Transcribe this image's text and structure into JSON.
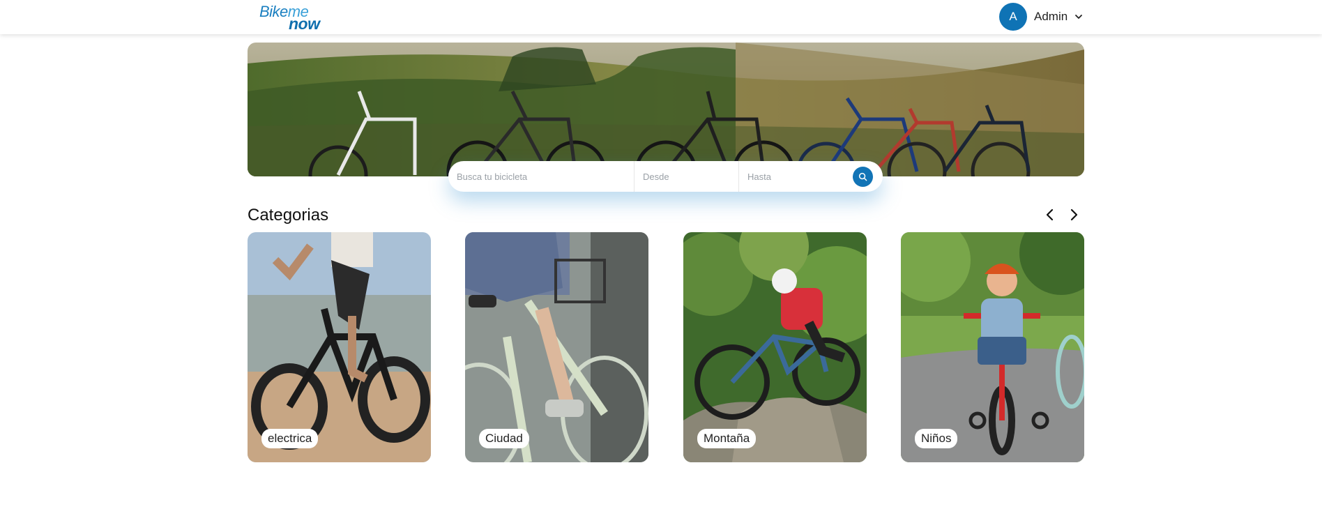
{
  "header": {
    "logo_line1": "Bike",
    "logo_line1b": "me",
    "logo_line2": "now",
    "user_initial": "A",
    "user_name": "Admin"
  },
  "search": {
    "bike_placeholder": "Busca tu bicicleta",
    "from_placeholder": "Desde",
    "to_placeholder": "Hasta"
  },
  "categories": {
    "title": "Categorias",
    "items": [
      {
        "label": "electrica"
      },
      {
        "label": "Ciudad"
      },
      {
        "label": "Montaña"
      },
      {
        "label": "Niños"
      }
    ]
  },
  "colors": {
    "brand": "#0f73b5",
    "accent": "#3aa0d8"
  },
  "icons": {
    "avatar": "avatar-icon",
    "dropdown": "chevron-down-icon",
    "search": "search-icon",
    "prev": "chevron-left-icon",
    "next": "chevron-right-icon"
  }
}
